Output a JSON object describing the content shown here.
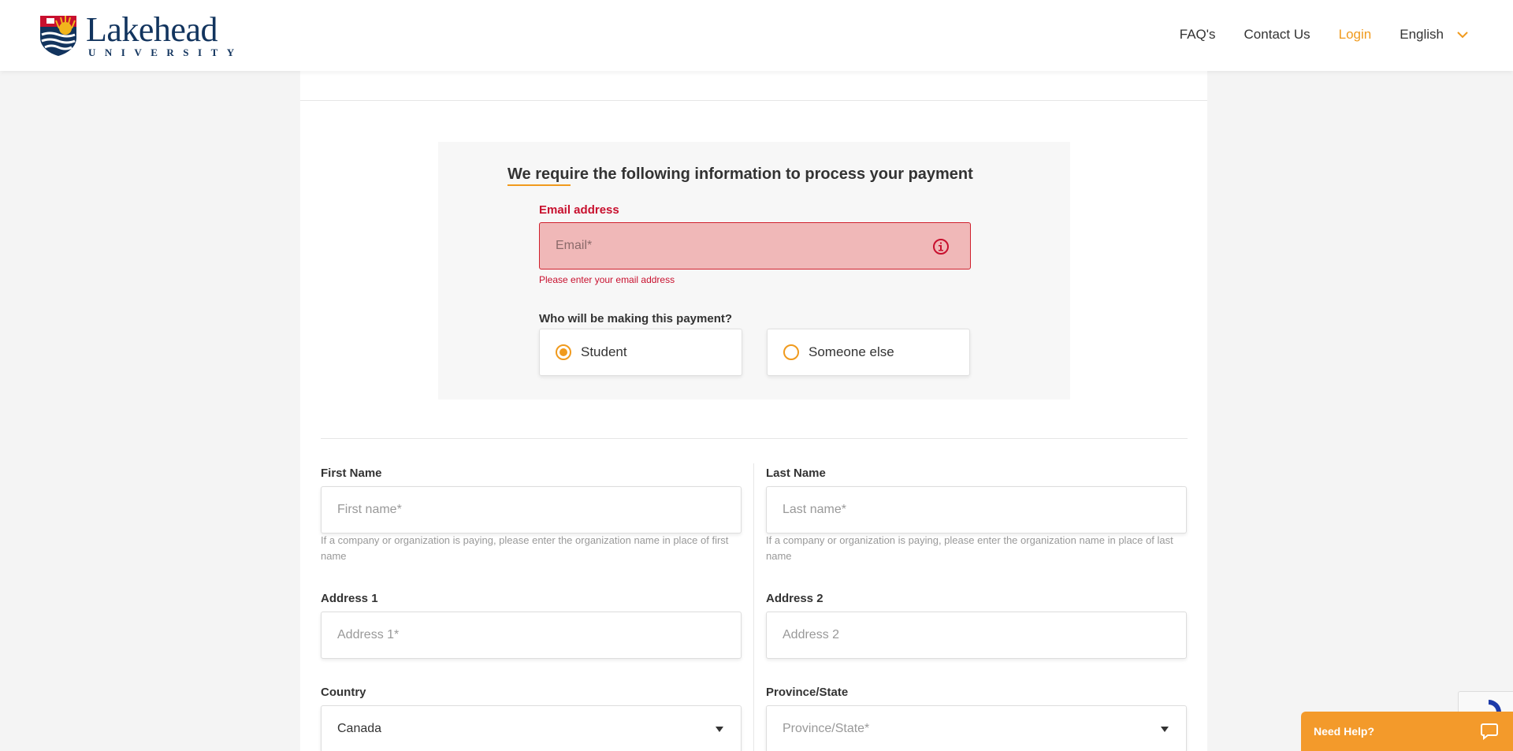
{
  "header": {
    "logo_name": "Lakehead",
    "logo_sub": "UNIVERSITY",
    "nav": {
      "faq": "FAQ's",
      "contact": "Contact Us",
      "login": "Login",
      "language": "English"
    }
  },
  "payment_info": {
    "title": "We require the following information to process your payment",
    "email_label": "Email address",
    "email_placeholder": "Email*",
    "email_error": "Please enter your email address",
    "payer_label": "Who will be making this payment?",
    "options": {
      "student": "Student",
      "someone_else": "Someone else"
    },
    "selected": "student"
  },
  "form": {
    "first_name_label": "First Name",
    "first_name_placeholder": "First name*",
    "first_name_hint": "If a company or organization is paying, please enter the organization name in place of first name",
    "last_name_label": "Last Name",
    "last_name_placeholder": "Last name*",
    "last_name_hint": "If a company or organization is paying, please enter the organization name in place of last name",
    "address1_label": "Address 1",
    "address1_placeholder": "Address 1*",
    "address2_label": "Address 2",
    "address2_placeholder": "Address 2",
    "country_label": "Country",
    "country_value": "Canada",
    "province_label": "Province/State",
    "province_placeholder": "Province/State*"
  },
  "help": {
    "label": "Need Help?"
  },
  "colors": {
    "accent": "#f09a1d",
    "error": "#c8102e",
    "brand_navy": "#12345e"
  }
}
